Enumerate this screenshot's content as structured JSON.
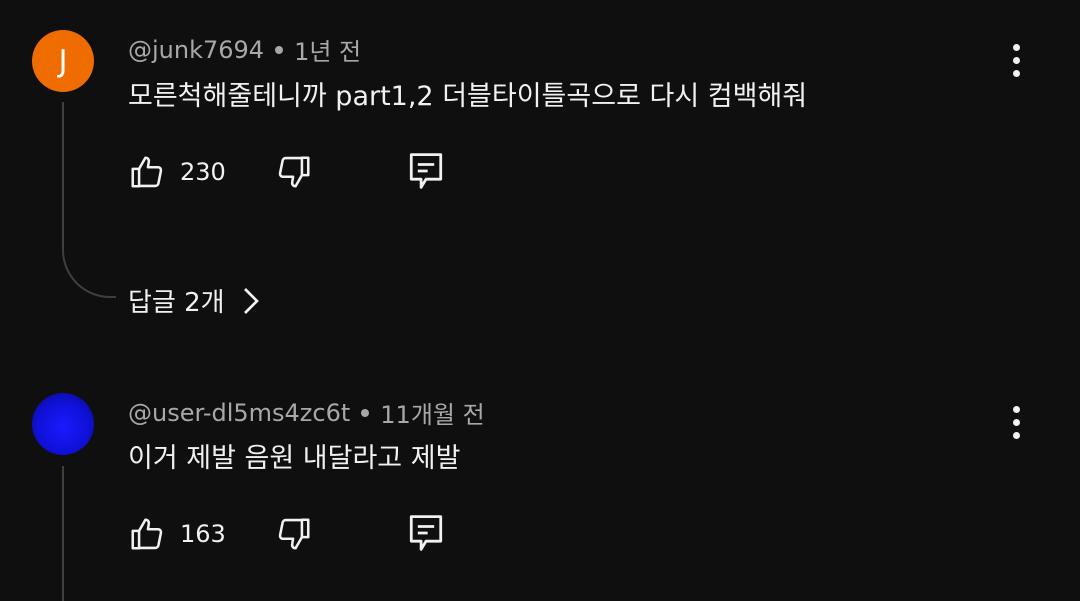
{
  "comments": [
    {
      "avatar_letter": "J",
      "avatar_color": "#ef6c00",
      "handle": "@junk7694",
      "time": "1년 전",
      "text": "모른척해줄테니까 part1,2 더블타이틀곡으로 다시 컴백해줘",
      "likes": "230",
      "replies_label": "답글 2개"
    },
    {
      "avatar_letter": "",
      "avatar_color": "#1a1aff",
      "handle": "@user-dl5ms4zc6t",
      "time": "11개월 전",
      "text": "이거 제발 음원 내달라고 제발",
      "likes": "163"
    }
  ],
  "icons": {
    "like": "thumbs-up-icon",
    "dislike": "thumbs-down-icon",
    "reply": "reply-comment-icon",
    "more": "more-vert-icon",
    "chevron": "chevron-right-icon"
  }
}
